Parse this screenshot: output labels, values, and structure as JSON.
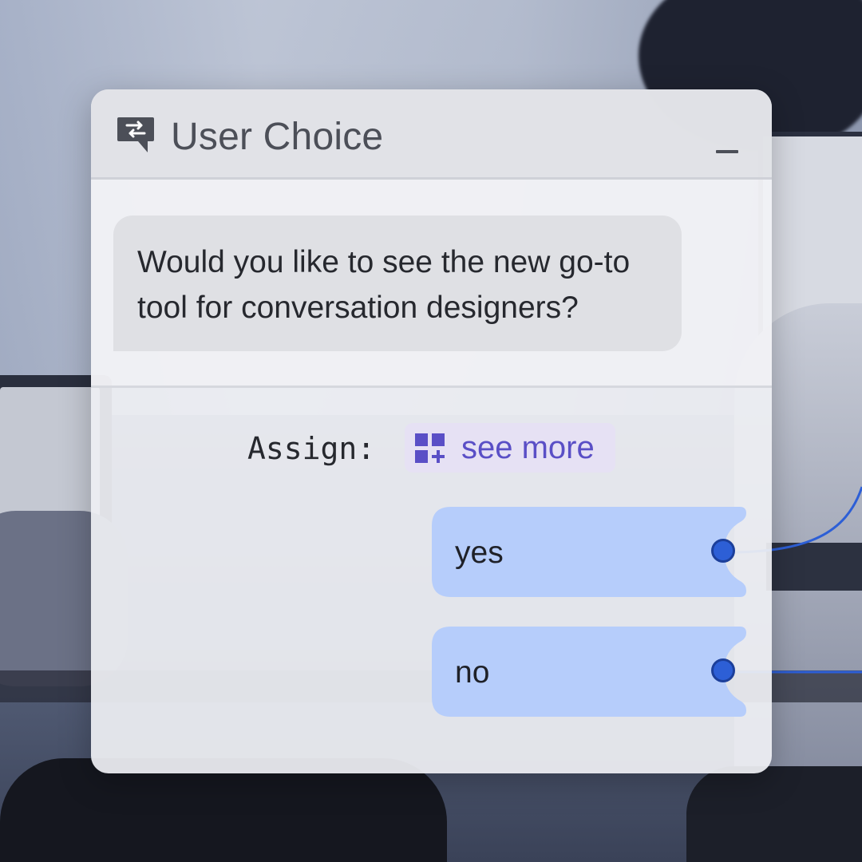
{
  "window": {
    "title": "User Choice",
    "icon": "chat-swap-icon",
    "minimize_icon": "minimize-icon"
  },
  "message": {
    "text_line1": "Would you like to see the new go-to",
    "text_line2": "tool for conversation designers?"
  },
  "assign": {
    "label": "Assign:",
    "chip_icon": "grid-plus-icon",
    "chip_label": "see more"
  },
  "choices": [
    {
      "label": "yes"
    },
    {
      "label": "no"
    }
  ],
  "colors": {
    "chip_bg": "#e6e1f4",
    "chip_text": "#5a4fc6",
    "choice_bg": "#b6cdfb",
    "port": "#2d5fd6",
    "connector": "#2d5fd6"
  }
}
